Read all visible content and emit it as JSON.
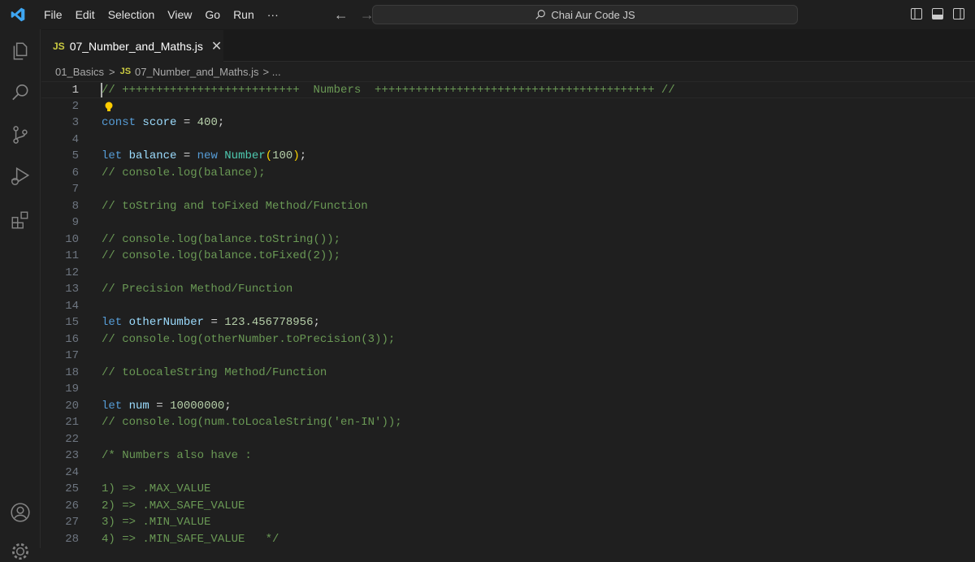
{
  "menu": [
    "File",
    "Edit",
    "Selection",
    "View",
    "Go",
    "Run",
    "···"
  ],
  "search": {
    "text": "Chai Aur Code JS"
  },
  "tab": {
    "badge": "JS",
    "label": "07_Number_and_Maths.js",
    "close": "✕"
  },
  "breadcrumb": {
    "folder": "01_Basics",
    "sep": ">",
    "badge": "JS",
    "file": "07_Number_and_Maths.js",
    "tail": "> ..."
  },
  "editor": {
    "active_line": 1,
    "lines": [
      {
        "n": "1",
        "parts": [
          [
            "cm",
            "// ++++++++++++++++++++++++++  Numbers  +++++++++++++++++++++++++++++++++++++++++ //"
          ]
        ]
      },
      {
        "n": "2",
        "parts": []
      },
      {
        "n": "3",
        "parts": [
          [
            "kw",
            "const"
          ],
          [
            "op",
            " "
          ],
          [
            "var",
            "score"
          ],
          [
            "op",
            " = "
          ],
          [
            "num",
            "400"
          ],
          [
            "op",
            ";"
          ]
        ]
      },
      {
        "n": "4",
        "parts": []
      },
      {
        "n": "5",
        "parts": [
          [
            "kw",
            "let"
          ],
          [
            "op",
            " "
          ],
          [
            "var",
            "balance"
          ],
          [
            "op",
            " = "
          ],
          [
            "kw",
            "new"
          ],
          [
            "op",
            " "
          ],
          [
            "cls",
            "Number"
          ],
          [
            "par",
            "("
          ],
          [
            "num",
            "100"
          ],
          [
            "par",
            ")"
          ],
          [
            "op",
            ";"
          ]
        ]
      },
      {
        "n": "6",
        "parts": [
          [
            "cm",
            "// console.log(balance);"
          ]
        ]
      },
      {
        "n": "7",
        "parts": []
      },
      {
        "n": "8",
        "parts": [
          [
            "cm",
            "// toString and toFixed Method/Function"
          ]
        ]
      },
      {
        "n": "9",
        "parts": []
      },
      {
        "n": "10",
        "parts": [
          [
            "cm",
            "// console.log(balance.toString());"
          ]
        ]
      },
      {
        "n": "11",
        "parts": [
          [
            "cm",
            "// console.log(balance.toFixed(2));"
          ]
        ]
      },
      {
        "n": "12",
        "parts": []
      },
      {
        "n": "13",
        "parts": [
          [
            "cm",
            "// Precision Method/Function"
          ]
        ]
      },
      {
        "n": "14",
        "parts": []
      },
      {
        "n": "15",
        "parts": [
          [
            "kw",
            "let"
          ],
          [
            "op",
            " "
          ],
          [
            "var",
            "otherNumber"
          ],
          [
            "op",
            " = "
          ],
          [
            "num",
            "123.456778956"
          ],
          [
            "op",
            ";"
          ]
        ]
      },
      {
        "n": "16",
        "parts": [
          [
            "cm",
            "// console.log(otherNumber.toPrecision(3));"
          ]
        ]
      },
      {
        "n": "17",
        "parts": []
      },
      {
        "n": "18",
        "parts": [
          [
            "cm",
            "// toLocaleString Method/Function"
          ]
        ]
      },
      {
        "n": "19",
        "parts": []
      },
      {
        "n": "20",
        "parts": [
          [
            "kw",
            "let"
          ],
          [
            "op",
            " "
          ],
          [
            "var",
            "num"
          ],
          [
            "op",
            " = "
          ],
          [
            "num",
            "10000000"
          ],
          [
            "op",
            ";"
          ]
        ]
      },
      {
        "n": "21",
        "parts": [
          [
            "cm",
            "// console.log(num.toLocaleString('en-IN'));"
          ]
        ]
      },
      {
        "n": "22",
        "parts": []
      },
      {
        "n": "23",
        "parts": [
          [
            "cm",
            "/* Numbers also have :"
          ]
        ]
      },
      {
        "n": "24",
        "parts": []
      },
      {
        "n": "25",
        "parts": [
          [
            "cm",
            "1) => .MAX_VALUE"
          ]
        ]
      },
      {
        "n": "26",
        "parts": [
          [
            "cm",
            "2) => .MAX_SAFE_VALUE"
          ]
        ]
      },
      {
        "n": "27",
        "parts": [
          [
            "cm",
            "3) => .MIN_VALUE"
          ]
        ]
      },
      {
        "n": "28",
        "parts": [
          [
            "cm",
            "4) => .MIN_SAFE_VALUE   */"
          ]
        ]
      }
    ]
  },
  "icons": [
    "vscode-logo-icon",
    "back-arrow-icon",
    "forward-arrow-icon",
    "search-icon",
    "toggle-sidebar-icon",
    "toggle-panel-icon",
    "toggle-secondary-sidebar-icon",
    "explorer-icon",
    "search-view-icon",
    "source-control-icon",
    "run-debug-icon",
    "extensions-icon",
    "accounts-icon",
    "manage-gear-icon",
    "lightbulb-icon"
  ],
  "colors": {
    "keyword": "#569cd6",
    "variable": "#9cdcfe",
    "number": "#b5cea8",
    "class": "#4ec9b0",
    "comment": "#6a9955",
    "js_badge": "#cbcb41",
    "background": "#1f1f1f"
  }
}
